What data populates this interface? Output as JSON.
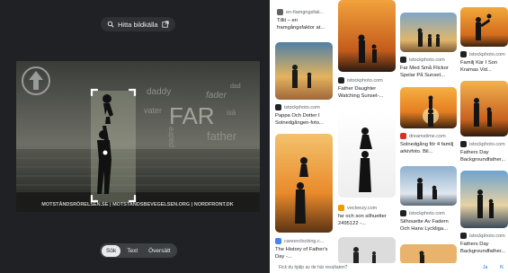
{
  "lens": {
    "source_button_label": "Hitta bildkälla",
    "source_icon": "lens-icon",
    "open_icon": "open-external-icon",
    "modes": [
      "Sök",
      "Text",
      "Översätt"
    ],
    "active_mode": "Sök",
    "image": {
      "words": [
        "daddy",
        "fader",
        "dad",
        "vater",
        "FAR",
        "isä",
        "padre",
        "father"
      ],
      "banner": "MOTSTÅNDSRÖRELSEN.SE | MOTSTANDSBEVEGELSEN.ORG | NORDFRONT.DK"
    }
  },
  "results": [
    {
      "source": "en-fiamgngsfak...",
      "caption": "Tillit – en framgångsfaktor at...",
      "fav_color": "#5f6368"
    },
    {
      "source": "",
      "caption": "",
      "fav_color": "#5f6368"
    },
    {
      "source": "",
      "caption": "",
      "fav_color": "#5f6368"
    },
    {
      "source": "istockphoto.com",
      "caption": "Familj Kär I Son Kramas Vid...",
      "fav_color": "#202124"
    },
    {
      "source": "istockphoto.com",
      "caption": "Far Med Små Flickor Spelar På Sunset...",
      "fav_color": "#202124"
    },
    {
      "source": "istockphoto.com",
      "caption": "Father Daughter Watching Sunset-...",
      "fav_color": "#202124"
    },
    {
      "source": "istockphoto.com",
      "caption": "Pappa Och Dotter I Solnedgången-foto...",
      "fav_color": "#202124"
    },
    {
      "source": "istockphoto.com",
      "caption": "Fathers Day Backgroundfather...",
      "fav_color": "#202124"
    },
    {
      "source": "dreamstime.com",
      "caption": "Solnedgång för 4 familj arkivfoto. Bil...",
      "fav_color": "#d93025"
    },
    {
      "source": "vecteezy.com",
      "caption": "far och son silhuetter 2495122 -...",
      "fav_color": "#f29900"
    },
    {
      "source": "istockphoto.com",
      "caption": "Silhouette Av Fadern Och Hans Lyckliga...",
      "fav_color": "#202124"
    },
    {
      "source": "istockphoto.com",
      "caption": "Fathers Day Backgroundfather...",
      "fav_color": "#202124"
    },
    {
      "source": "careerclocking.c...",
      "caption": "The History of Father's Day -...",
      "fav_color": "#4285f4"
    }
  ],
  "footer": {
    "question": "Fick du hjälp av de här resultaten?",
    "yes": "Ja",
    "no": "N"
  }
}
